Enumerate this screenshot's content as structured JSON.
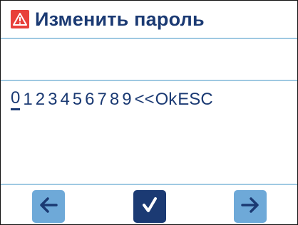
{
  "header": {
    "title": "Изменить пароль",
    "icon": "warning-icon"
  },
  "input": {
    "keys": [
      "0",
      "1",
      "2",
      "3",
      "4",
      "5",
      "6",
      "7",
      "8",
      "9",
      "<<",
      "Ok",
      "ESC"
    ],
    "selected_key": "0"
  },
  "footer": {
    "prev_icon": "arrow-left-icon",
    "ok_icon": "checkmark-icon",
    "next_icon": "arrow-right-icon"
  },
  "colors": {
    "title_text": "#1b3a73",
    "divider": "#9fc9e2",
    "warning": "#e8403a",
    "button_light": "#6ea9d8",
    "button_dark": "#1b3a73"
  }
}
